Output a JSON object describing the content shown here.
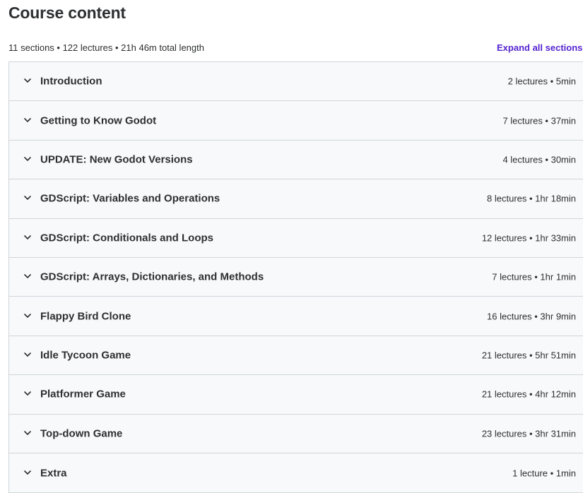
{
  "header": {
    "title": "Course content",
    "summary": "11 sections • 122 lectures • 21h 46m total length",
    "expand_all_label": "Expand all sections"
  },
  "icons": {
    "section_toggle": "chevron-down-icon"
  },
  "colors": {
    "accent": "#5624d0",
    "section_bg": "#f7f9fa",
    "border": "#d1d7dc",
    "text": "#2d2f31"
  },
  "sections": [
    {
      "title": "Introduction",
      "meta": "2 lectures • 5min"
    },
    {
      "title": "Getting to Know Godot",
      "meta": "7 lectures • 37min"
    },
    {
      "title": "UPDATE: New Godot Versions",
      "meta": "4 lectures • 30min"
    },
    {
      "title": "GDScript: Variables and Operations",
      "meta": "8 lectures • 1hr 18min"
    },
    {
      "title": "GDScript: Conditionals and Loops",
      "meta": "12 lectures • 1hr 33min"
    },
    {
      "title": "GDScript: Arrays, Dictionaries, and Methods",
      "meta": "7 lectures • 1hr 1min"
    },
    {
      "title": "Flappy Bird Clone",
      "meta": "16 lectures • 3hr 9min"
    },
    {
      "title": "Idle Tycoon Game",
      "meta": "21 lectures • 5hr 51min"
    },
    {
      "title": "Platformer Game",
      "meta": "21 lectures • 4hr 12min"
    },
    {
      "title": "Top-down Game",
      "meta": "23 lectures • 3hr 31min"
    },
    {
      "title": "Extra",
      "meta": "1 lecture • 1min"
    }
  ]
}
